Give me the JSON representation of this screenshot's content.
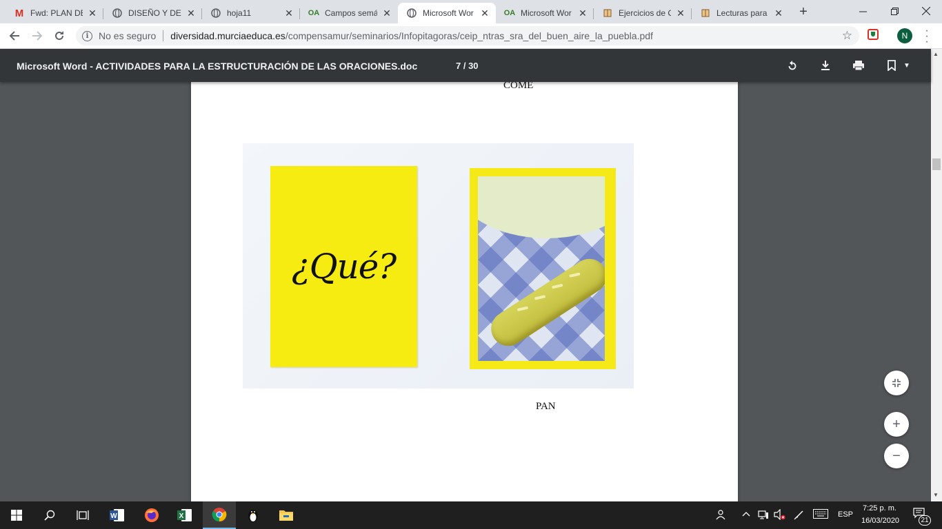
{
  "browser": {
    "tabs": [
      {
        "title": "Fwd: PLAN DE",
        "favicon": "gmail-icon",
        "active": false
      },
      {
        "title": "DISEÑO Y DES",
        "favicon": "globe-icon",
        "active": false
      },
      {
        "title": "hoja11",
        "favicon": "globe-icon",
        "active": false
      },
      {
        "title": "Campos semá",
        "favicon": "oa-icon",
        "favicon_text": "OA",
        "active": false
      },
      {
        "title": "Microsoft Wor",
        "favicon": "globe-icon",
        "active": true
      },
      {
        "title": "Microsoft Wor",
        "favicon": "oa-icon",
        "favicon_text": "OA",
        "active": false
      },
      {
        "title": "Ejercicios de C",
        "favicon": "book-icon",
        "active": false
      },
      {
        "title": "Lecturas para",
        "favicon": "book-icon",
        "active": false
      }
    ],
    "address": {
      "security_label": "No es seguro",
      "host": "diversidad.murciaeduca.es",
      "path": "/compensamur/seminarios/Infopitagoras/ceip_ntras_sra_del_buen_aire_la_puebla.pdf"
    },
    "profile_initial": "N"
  },
  "pdf": {
    "title": "Microsoft Word - ACTIVIDADES PARA LA ESTRUCTURACIÓN DE LAS ORACIONES.doc",
    "page_indicator": "7 / 30",
    "content": {
      "top_word": "COME",
      "card_question": "¿Qué?",
      "bottom_word": "PAN"
    }
  },
  "taskbar": {
    "language": "ESP",
    "time": "7:25 p. m.",
    "date": "16/03/2020",
    "notifications": "21"
  },
  "colors": {
    "tab_strip": "#dee1e6",
    "pdf_toolbar": "#323639",
    "viewer_background": "#525659",
    "card_yellow": "#f6ec12",
    "taskbar": "#1f1f1f"
  }
}
